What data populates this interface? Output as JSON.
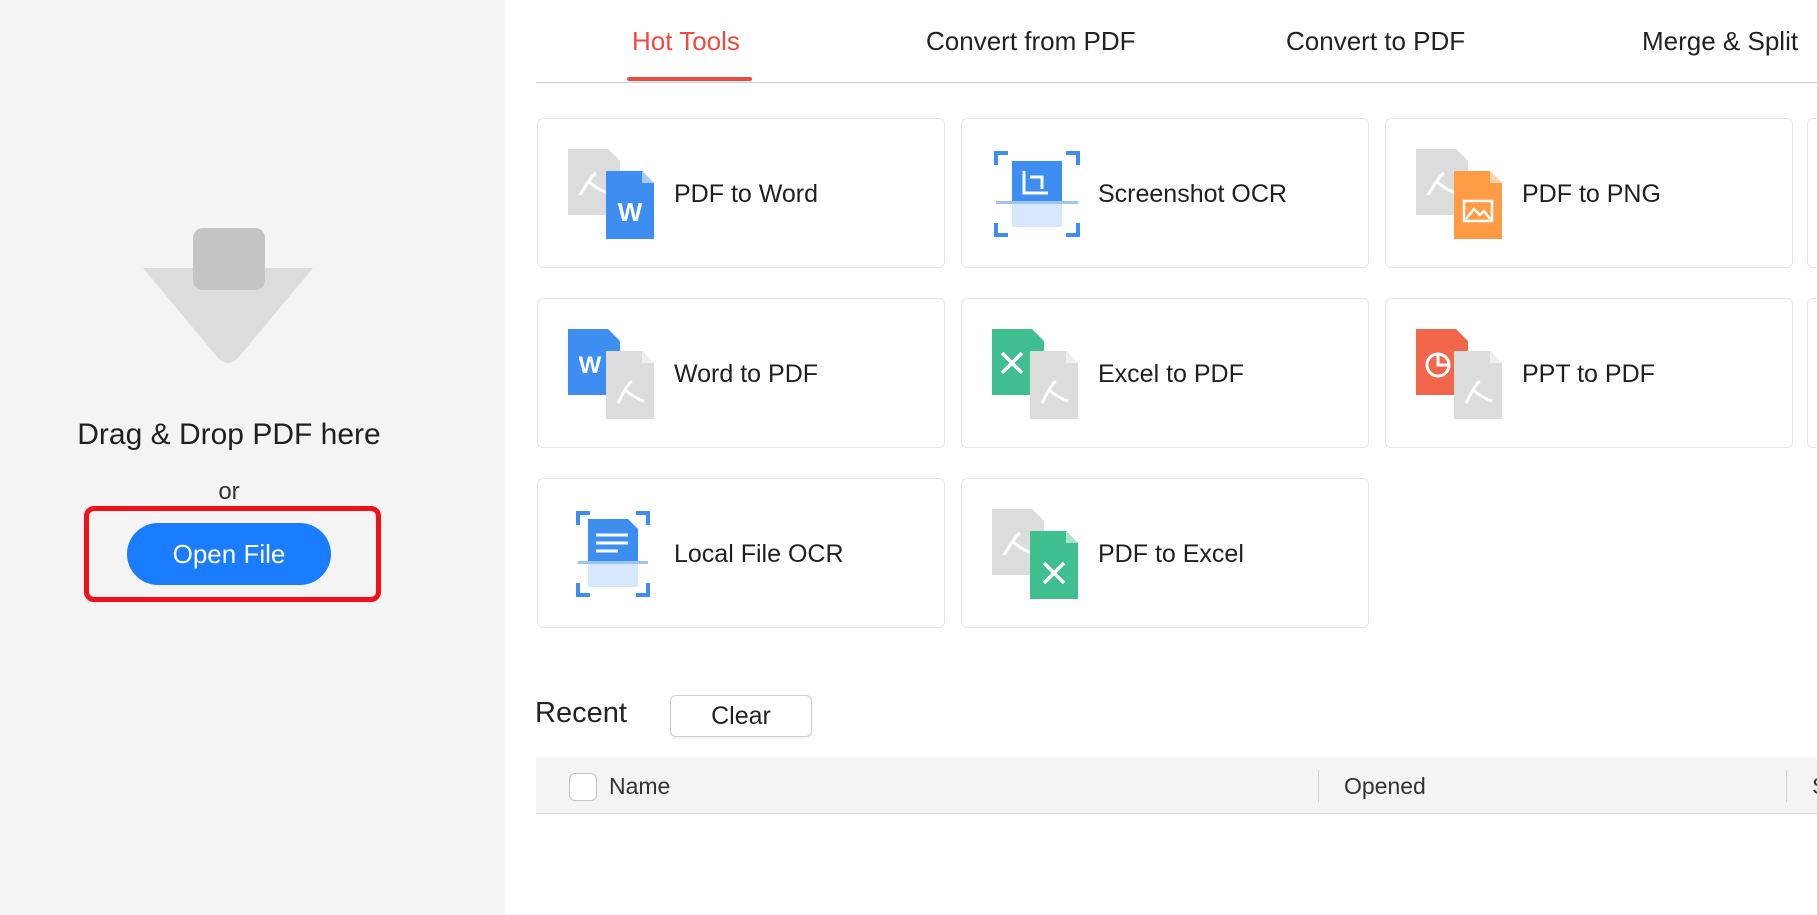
{
  "drop_panel": {
    "drop_text": "Drag & Drop PDF here",
    "or_text": "or",
    "open_file_label": "Open File"
  },
  "tabs": [
    {
      "label": "Hot Tools",
      "active": true
    },
    {
      "label": "Convert from PDF",
      "active": false
    },
    {
      "label": "Convert to PDF",
      "active": false
    },
    {
      "label": "Merge & Split",
      "active": false
    }
  ],
  "tools": [
    {
      "label": "PDF to Word",
      "icon": "pdf-to-word-icon"
    },
    {
      "label": "Screenshot OCR",
      "icon": "screenshot-ocr-icon"
    },
    {
      "label": "PDF to PNG",
      "icon": "pdf-to-png-icon"
    },
    {
      "label": "Word to PDF",
      "icon": "word-to-pdf-icon"
    },
    {
      "label": "Excel to PDF",
      "icon": "excel-to-pdf-icon"
    },
    {
      "label": "PPT to PDF",
      "icon": "ppt-to-pdf-icon"
    },
    {
      "label": "Local File OCR",
      "icon": "local-file-ocr-icon"
    },
    {
      "label": "PDF to Excel",
      "icon": "pdf-to-excel-icon"
    }
  ],
  "recent": {
    "title": "Recent",
    "clear_label": "Clear",
    "columns": [
      "Name",
      "Opened",
      "S"
    ]
  },
  "colors": {
    "accent_red": "#ef4a3f",
    "primary_blue": "#1a7cff",
    "highlight_red": "#f2101a",
    "word_blue": "#3d8ef0",
    "excel_green": "#3fbf8f",
    "ppt_orange": "#f2674b",
    "png_orange": "#ff9a45",
    "pdf_gray": "#d6d6d6"
  }
}
